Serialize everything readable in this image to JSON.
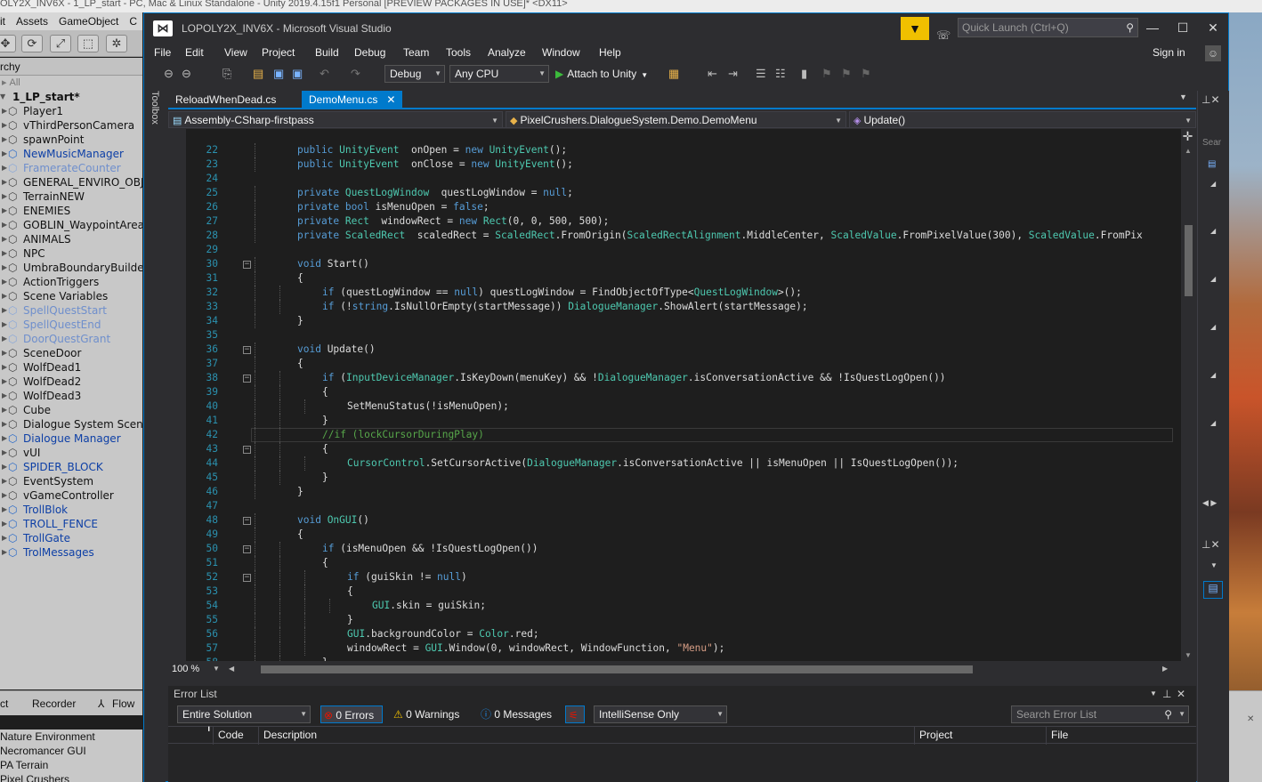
{
  "unity": {
    "title": "OLY2X_INV6X - 1_LP_start - PC, Mac & Linux Standalone - Unity 2019.4.15f1 Personal [PREVIEW PACKAGES IN USE]* <DX11>",
    "menu": [
      "it",
      "Assets",
      "GameObject",
      "C"
    ],
    "hierarchy_label": "rchy",
    "hierarchy_search": "All",
    "scene_name": "1_LP_start*",
    "hierarchy_items": [
      {
        "label": "Player1",
        "style": "normal"
      },
      {
        "label": "vThirdPersonCamera",
        "style": "normal"
      },
      {
        "label": "spawnPoint",
        "style": "normal"
      },
      {
        "label": "NewMusicManager",
        "style": "prefab"
      },
      {
        "label": "FramerateCounter",
        "style": "faded"
      },
      {
        "label": "GENERAL_ENVIRO_OBJ",
        "style": "normal"
      },
      {
        "label": "TerrainNEW",
        "style": "normal"
      },
      {
        "label": "ENEMIES",
        "style": "normal"
      },
      {
        "label": "GOBLIN_WaypointArea",
        "style": "normal"
      },
      {
        "label": "ANIMALS",
        "style": "normal"
      },
      {
        "label": "NPC",
        "style": "normal"
      },
      {
        "label": "UmbraBoundaryBuilder",
        "style": "normal"
      },
      {
        "label": "ActionTriggers",
        "style": "normal"
      },
      {
        "label": "Scene Variables",
        "style": "normal"
      },
      {
        "label": "SpellQuestStart",
        "style": "faded"
      },
      {
        "label": "SpellQuestEnd",
        "style": "faded"
      },
      {
        "label": "DoorQuestGrant",
        "style": "faded"
      },
      {
        "label": "SceneDoor",
        "style": "normal"
      },
      {
        "label": "WolfDead1",
        "style": "normal"
      },
      {
        "label": "WolfDead2",
        "style": "normal"
      },
      {
        "label": "WolfDead3",
        "style": "normal"
      },
      {
        "label": "Cube",
        "style": "normal"
      },
      {
        "label": "Dialogue System Scene",
        "style": "normal"
      },
      {
        "label": "Dialogue Manager",
        "style": "prefab"
      },
      {
        "label": "vUI",
        "style": "normal"
      },
      {
        "label": "SPIDER_BLOCK",
        "style": "prefab"
      },
      {
        "label": "EventSystem",
        "style": "normal"
      },
      {
        "label": "vGameController",
        "style": "normal"
      },
      {
        "label": "TrollBlok",
        "style": "prefab"
      },
      {
        "label": "TROLL_FENCE",
        "style": "prefab"
      },
      {
        "label": "TrollGate",
        "style": "prefab"
      },
      {
        "label": "TrolMessages",
        "style": "prefab"
      }
    ],
    "bottom_tabs": [
      "ct",
      "Recorder",
      "Flow"
    ],
    "bottom_list": [
      "Nature Environment",
      "Necromancer GUI",
      "PA Terrain",
      "Pixel Crushers"
    ]
  },
  "vs": {
    "title": "LOPOLY2X_INV6X - Microsoft Visual Studio",
    "quick_launch_placeholder": "Quick Launch (Ctrl+Q)",
    "menu": [
      "File",
      "Edit",
      "View",
      "Project",
      "Build",
      "Debug",
      "Team",
      "Tools",
      "Analyze",
      "Window",
      "Help"
    ],
    "sign_in": "Sign in",
    "config": "Debug",
    "platform": "Any CPU",
    "attach": "Attach to Unity",
    "toolbox": "Toolbox",
    "tabs": [
      {
        "label": "ReloadWhenDead.cs",
        "active": false
      },
      {
        "label": "DemoMenu.cs",
        "active": true
      }
    ],
    "nav": {
      "project": "Assembly-CSharp-firstpass",
      "type": "PixelCrushers.DialogueSystem.Demo.DemoMenu",
      "member": "Update()"
    },
    "zoom": "100 %",
    "error_list": {
      "title": "Error List",
      "scope": "Entire Solution",
      "errors": "0 Errors",
      "warnings": "0 Warnings",
      "messages": "0 Messages",
      "build_filter": "IntelliSense Only",
      "search_placeholder": "Search Error List",
      "columns": [
        "Code",
        "Description",
        "Project",
        "File"
      ]
    },
    "right_panel_search": "Sear"
  },
  "code_lines": [
    {
      "n": "22",
      "indent": 2,
      "fold": false,
      "tokens": [
        [
          "kw",
          "public "
        ],
        [
          "ty",
          "UnityEvent"
        ],
        [
          "",
          "  onOpen = "
        ],
        [
          "kw",
          "new "
        ],
        [
          "ty",
          "UnityEvent"
        ],
        [
          "",
          "();"
        ]
      ]
    },
    {
      "n": "23",
      "indent": 2,
      "fold": false,
      "tokens": [
        [
          "kw",
          "public "
        ],
        [
          "ty",
          "UnityEvent"
        ],
        [
          "",
          "  onClose = "
        ],
        [
          "kw",
          "new "
        ],
        [
          "ty",
          "UnityEvent"
        ],
        [
          "",
          "();"
        ]
      ]
    },
    {
      "n": "24",
      "indent": 0,
      "fold": false,
      "tokens": []
    },
    {
      "n": "25",
      "indent": 2,
      "fold": false,
      "tokens": [
        [
          "kw",
          "private "
        ],
        [
          "ty",
          "QuestLogWindow"
        ],
        [
          "",
          "  questLogWindow = "
        ],
        [
          "kw",
          "null"
        ],
        [
          "",
          ";"
        ]
      ]
    },
    {
      "n": "26",
      "indent": 2,
      "fold": false,
      "tokens": [
        [
          "kw",
          "private bool "
        ],
        [
          "",
          "isMenuOpen = "
        ],
        [
          "kw",
          "false"
        ],
        [
          "",
          ";"
        ]
      ]
    },
    {
      "n": "27",
      "indent": 2,
      "fold": false,
      "tokens": [
        [
          "kw",
          "private "
        ],
        [
          "ty",
          "Rect"
        ],
        [
          "",
          "  windowRect = "
        ],
        [
          "kw",
          "new "
        ],
        [
          "ty",
          "Rect"
        ],
        [
          "",
          "(0, 0, 500, 500);"
        ]
      ]
    },
    {
      "n": "28",
      "indent": 2,
      "fold": false,
      "tokens": [
        [
          "kw",
          "private "
        ],
        [
          "ty",
          "ScaledRect"
        ],
        [
          "",
          "  scaledRect = "
        ],
        [
          "ty",
          "ScaledRect"
        ],
        [
          "",
          ".FromOrigin("
        ],
        [
          "ty",
          "ScaledRectAlignment"
        ],
        [
          "",
          ".MiddleCenter, "
        ],
        [
          "ty",
          "ScaledValue"
        ],
        [
          "",
          ".FromPixelValue(300), "
        ],
        [
          "ty",
          "ScaledValue"
        ],
        [
          "",
          ".FromPix"
        ]
      ]
    },
    {
      "n": "29",
      "indent": 0,
      "fold": false,
      "tokens": []
    },
    {
      "n": "30",
      "indent": 2,
      "fold": true,
      "tokens": [
        [
          "kw",
          "void "
        ],
        [
          "",
          "Start()"
        ]
      ]
    },
    {
      "n": "31",
      "indent": 2,
      "fold": false,
      "tokens": [
        [
          "",
          "{"
        ]
      ]
    },
    {
      "n": "32",
      "indent": 3,
      "fold": false,
      "tokens": [
        [
          "kw",
          "if "
        ],
        [
          "",
          "(questLogWindow == "
        ],
        [
          "kw",
          "null"
        ],
        [
          "",
          ") questLogWindow = FindObjectOfType<"
        ],
        [
          "ty",
          "QuestLogWindow"
        ],
        [
          "",
          ">();"
        ]
      ]
    },
    {
      "n": "33",
      "indent": 3,
      "fold": false,
      "tokens": [
        [
          "kw",
          "if "
        ],
        [
          "",
          "(!"
        ],
        [
          "kw",
          "string"
        ],
        [
          "",
          ".IsNullOrEmpty(startMessage)) "
        ],
        [
          "ty",
          "DialogueManager"
        ],
        [
          "",
          ".ShowAlert(startMessage);"
        ]
      ]
    },
    {
      "n": "34",
      "indent": 2,
      "fold": false,
      "tokens": [
        [
          "",
          "}"
        ]
      ]
    },
    {
      "n": "35",
      "indent": 0,
      "fold": false,
      "tokens": []
    },
    {
      "n": "36",
      "indent": 2,
      "fold": true,
      "tokens": [
        [
          "kw",
          "void "
        ],
        [
          "",
          "Update()"
        ]
      ]
    },
    {
      "n": "37",
      "indent": 2,
      "fold": false,
      "tokens": [
        [
          "",
          "{"
        ]
      ]
    },
    {
      "n": "38",
      "indent": 3,
      "fold": true,
      "tokens": [
        [
          "kw",
          "if "
        ],
        [
          "",
          "("
        ],
        [
          "ty",
          "InputDeviceManager"
        ],
        [
          "",
          ".IsKeyDown(menuKey) && !"
        ],
        [
          "ty",
          "DialogueManager"
        ],
        [
          "",
          ".isConversationActive && !IsQuestLogOpen())"
        ]
      ]
    },
    {
      "n": "39",
      "indent": 3,
      "fold": false,
      "tokens": [
        [
          "",
          "{"
        ]
      ]
    },
    {
      "n": "40",
      "indent": 4,
      "fold": false,
      "tokens": [
        [
          "",
          "SetMenuStatus(!isMenuOpen);"
        ]
      ]
    },
    {
      "n": "41",
      "indent": 3,
      "fold": false,
      "tokens": [
        [
          "",
          "}"
        ]
      ]
    },
    {
      "n": "42",
      "indent": 3,
      "fold": false,
      "highlight": true,
      "tokens": [
        [
          "cm",
          "//if (lockCursorDuringPlay)"
        ]
      ]
    },
    {
      "n": "43",
      "indent": 3,
      "fold": true,
      "tokens": [
        [
          "",
          "{"
        ]
      ]
    },
    {
      "n": "44",
      "indent": 4,
      "fold": false,
      "tokens": [
        [
          "ty",
          "CursorControl"
        ],
        [
          "",
          ".SetCursorActive("
        ],
        [
          "ty",
          "DialogueManager"
        ],
        [
          "",
          ".isConversationActive || isMenuOpen || IsQuestLogOpen());"
        ]
      ]
    },
    {
      "n": "45",
      "indent": 3,
      "fold": false,
      "tokens": [
        [
          "",
          "}"
        ]
      ]
    },
    {
      "n": "46",
      "indent": 2,
      "fold": false,
      "tokens": [
        [
          "",
          "}"
        ]
      ]
    },
    {
      "n": "47",
      "indent": 0,
      "fold": false,
      "tokens": []
    },
    {
      "n": "48",
      "indent": 2,
      "fold": true,
      "tokens": [
        [
          "kw",
          "void "
        ],
        [
          "ty",
          "OnGUI"
        ],
        [
          "",
          "()"
        ]
      ]
    },
    {
      "n": "49",
      "indent": 2,
      "fold": false,
      "tokens": [
        [
          "",
          "{"
        ]
      ]
    },
    {
      "n": "50",
      "indent": 3,
      "fold": true,
      "tokens": [
        [
          "kw",
          "if "
        ],
        [
          "",
          "(isMenuOpen && !IsQuestLogOpen())"
        ]
      ]
    },
    {
      "n": "51",
      "indent": 3,
      "fold": false,
      "tokens": [
        [
          "",
          "{"
        ]
      ]
    },
    {
      "n": "52",
      "indent": 4,
      "fold": true,
      "tokens": [
        [
          "kw",
          "if "
        ],
        [
          "",
          "(guiSkin != "
        ],
        [
          "kw",
          "null"
        ],
        [
          "",
          ")"
        ]
      ]
    },
    {
      "n": "53",
      "indent": 4,
      "fold": false,
      "tokens": [
        [
          "",
          "{"
        ]
      ]
    },
    {
      "n": "54",
      "indent": 5,
      "fold": false,
      "tokens": [
        [
          "ty",
          "GUI"
        ],
        [
          "",
          ".skin = guiSkin;"
        ]
      ]
    },
    {
      "n": "55",
      "indent": 4,
      "fold": false,
      "tokens": [
        [
          "",
          "}"
        ]
      ]
    },
    {
      "n": "56",
      "indent": 4,
      "fold": false,
      "tokens": [
        [
          "ty",
          "GUI"
        ],
        [
          "",
          ".backgroundColor = "
        ],
        [
          "ty",
          "Color"
        ],
        [
          "",
          ".red;"
        ]
      ]
    },
    {
      "n": "57",
      "indent": 4,
      "fold": false,
      "tokens": [
        [
          "",
          "windowRect = "
        ],
        [
          "ty",
          "GUI"
        ],
        [
          "",
          ".Window(0, windowRect, WindowFunction, "
        ],
        [
          "st",
          "\"Menu\""
        ],
        [
          "",
          ");"
        ]
      ]
    },
    {
      "n": "58",
      "indent": 3,
      "fold": false,
      "tokens": [
        [
          "",
          "}"
        ]
      ]
    }
  ]
}
